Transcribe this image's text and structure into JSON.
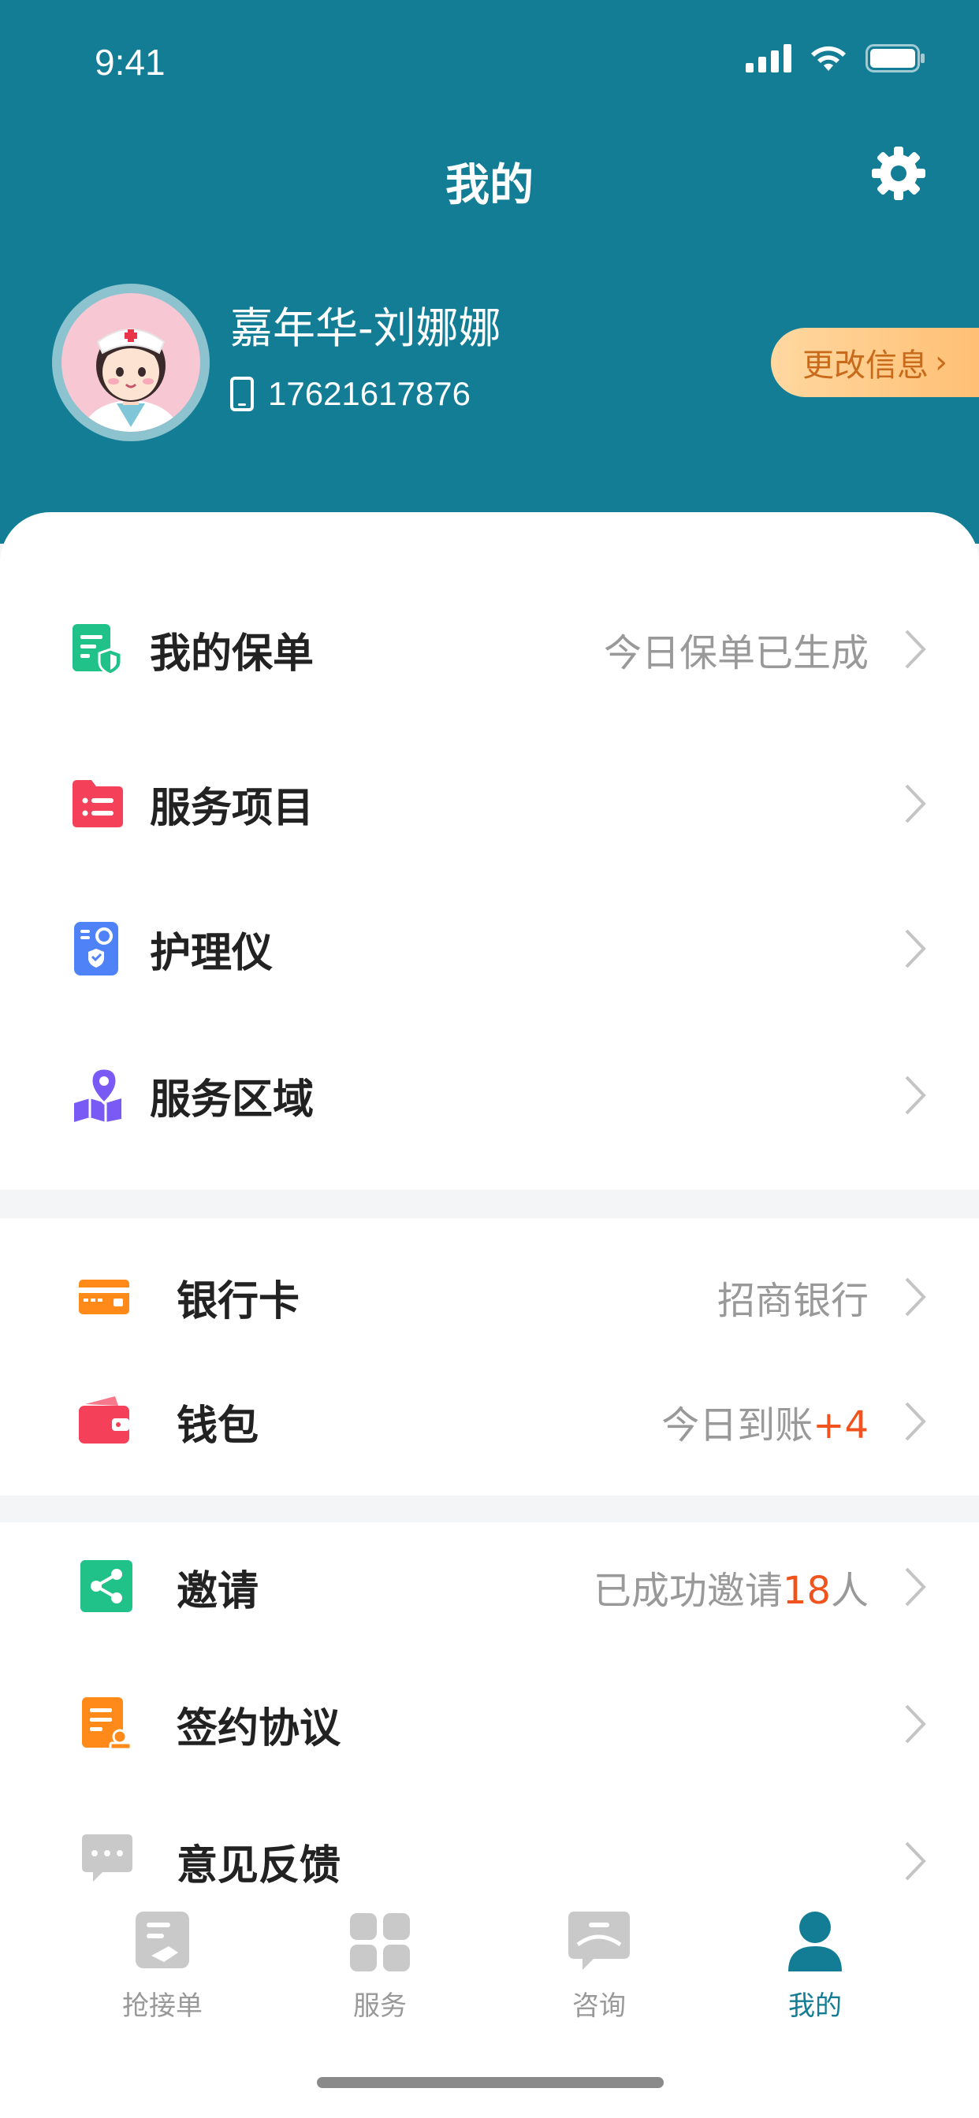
{
  "status": {
    "time": "9:41"
  },
  "header": {
    "title": "我的"
  },
  "profile": {
    "name": "嘉年华-刘娜娜",
    "phone": "17621617876",
    "edit_label": "更改信息",
    "edit_chevron": "›"
  },
  "menu_main": [
    {
      "label": "我的保单",
      "value": "今日保单已生成",
      "icon": "policy-shield-icon",
      "color": "#21c18a"
    },
    {
      "label": "服务项目",
      "value": "",
      "icon": "folder-list-icon",
      "color": "#f5405a"
    },
    {
      "label": "护理仪",
      "value": "",
      "icon": "camera-device-icon",
      "color": "#4e82f6"
    },
    {
      "label": "服务区域",
      "value": "",
      "icon": "map-pin-icon",
      "color": "#7a5af5"
    }
  ],
  "menu_finance": [
    {
      "label": "银行卡",
      "value": "招商银行",
      "icon": "bank-card-icon",
      "color": "#ff8a1a"
    },
    {
      "label": "钱包",
      "value_prefix": "今日到账",
      "value_highlight": "+4",
      "icon": "wallet-icon",
      "color": "#f5405a"
    }
  ],
  "menu_other": [
    {
      "label": "邀请",
      "value_prefix": "已成功邀请",
      "value_highlight": "18",
      "value_suffix": "人",
      "icon": "share-icon",
      "color": "#21c18a"
    },
    {
      "label": "签约协议",
      "value": "",
      "icon": "contract-icon",
      "color": "#ff8a1a"
    },
    {
      "label": "意见反馈",
      "value": "",
      "icon": "feedback-chat-icon",
      "color": "#c9c9c9"
    }
  ],
  "tabbar": [
    {
      "label": "抢接单",
      "icon": "grab-order-icon",
      "active": false
    },
    {
      "label": "服务",
      "icon": "service-grid-icon",
      "active": false
    },
    {
      "label": "咨询",
      "icon": "consult-chat-icon",
      "active": false
    },
    {
      "label": "我的",
      "icon": "user-profile-icon",
      "active": true
    }
  ],
  "colors": {
    "brand": "#137d96",
    "highlight": "#f0531e",
    "edit_button": "#ffbe72"
  }
}
